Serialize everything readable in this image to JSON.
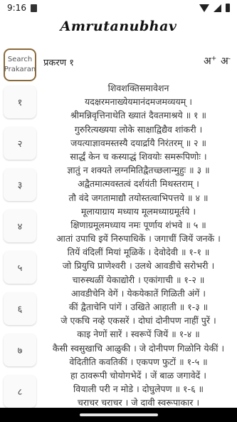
{
  "status_bar": {
    "time": "9:16"
  },
  "app": {
    "title": "Amrutanubhav"
  },
  "search": {
    "line1": "Search",
    "line2": "Prakaran"
  },
  "sidebar": {
    "items": [
      "१",
      "२",
      "३",
      "४",
      "५",
      "६",
      "७",
      "८"
    ]
  },
  "header": {
    "prakaran_title": "प्रकरण १",
    "font_increase": "अ",
    "font_decrease": "अ",
    "inc_sign": "+",
    "dec_sign": "-"
  },
  "verses": [
    "शिवशक्तिसमावेशन",
    "यदक्षरमनाख्येयमानंदमजमव्ययम् ।",
    "श्रीमन्निवृत्तिनाथेति ख्यातं दैवतमाश्रये ॥ १ ॥",
    "गुरुरित्यख्यया लोके साक्षाद्विद्यैव शांकरी ।",
    "जयत्याज्ञावमस्तस्यै दयार्द्रायै निरंतरम् ॥ २ ॥",
    "सार्द्धं केन च कस्याद्धं शिवयोः समरूपिणोः ।",
    "ज्ञातुं न शक्यते लग्नमितिद्वैतच्छलान्मुहुः ॥ ३ ॥",
    "अद्वैतमात्मवस्तत्वं दर्शयंती मिथस्तराम् ।",
    "तौ वंदे जगतामाद्यौ तयोस्तत्वाभिपत्तये ॥ ४ ॥",
    "मूलायाग्राय मध्याय मूलमध्याग्रमूर्तये ।",
    "क्षिणाग्रमूलमध्याय नमः पूर्णाय शंभवे ॥ ५ ॥",
    "आतां उपाधि इयें निरुपाधिकें । जगाचीं जियें जनकें ।",
    "तियें वंदिलीं मियां मूळिकें । देवोदेवी ॥ १-१ ॥",
    "जो प्रियुचि प्राणेश्वरी । उलथे आवडीचे सरोभरी ।",
    "चारुस्थळीं येकाद्योरी । एकांगाची ॥ १-२ ॥",
    "आवडीचेनि वेगें । येकयेकातें गिळिती अंगें ।",
    "कीं द्वैताचेनि पांगें । उखिते आहाती ॥ १-३ ॥",
    "जे एकचि नव्हे एकसरें । दोघां दोनीपण नाहीं पुरें ।",
    "काइ नेणों सारें । स्वरूपें जियें ॥ १-४ ॥",
    "कैसी स्वसुखाचि आळुकी । जे दोनीपण गिळोनि येकीं ।",
    "वेदितीति कवतिकीं । एकपण फुटों ॥ १-५ ॥",
    "हा ठावरूपी चोयोगभेदें । जें बाळ जगावेदें ।",
    "वियाली परी न मोडे । दोघुलेपण ॥ १-६ ॥",
    "चराचर चराचर । जे दावी स्वरूपाकार ।"
  ]
}
